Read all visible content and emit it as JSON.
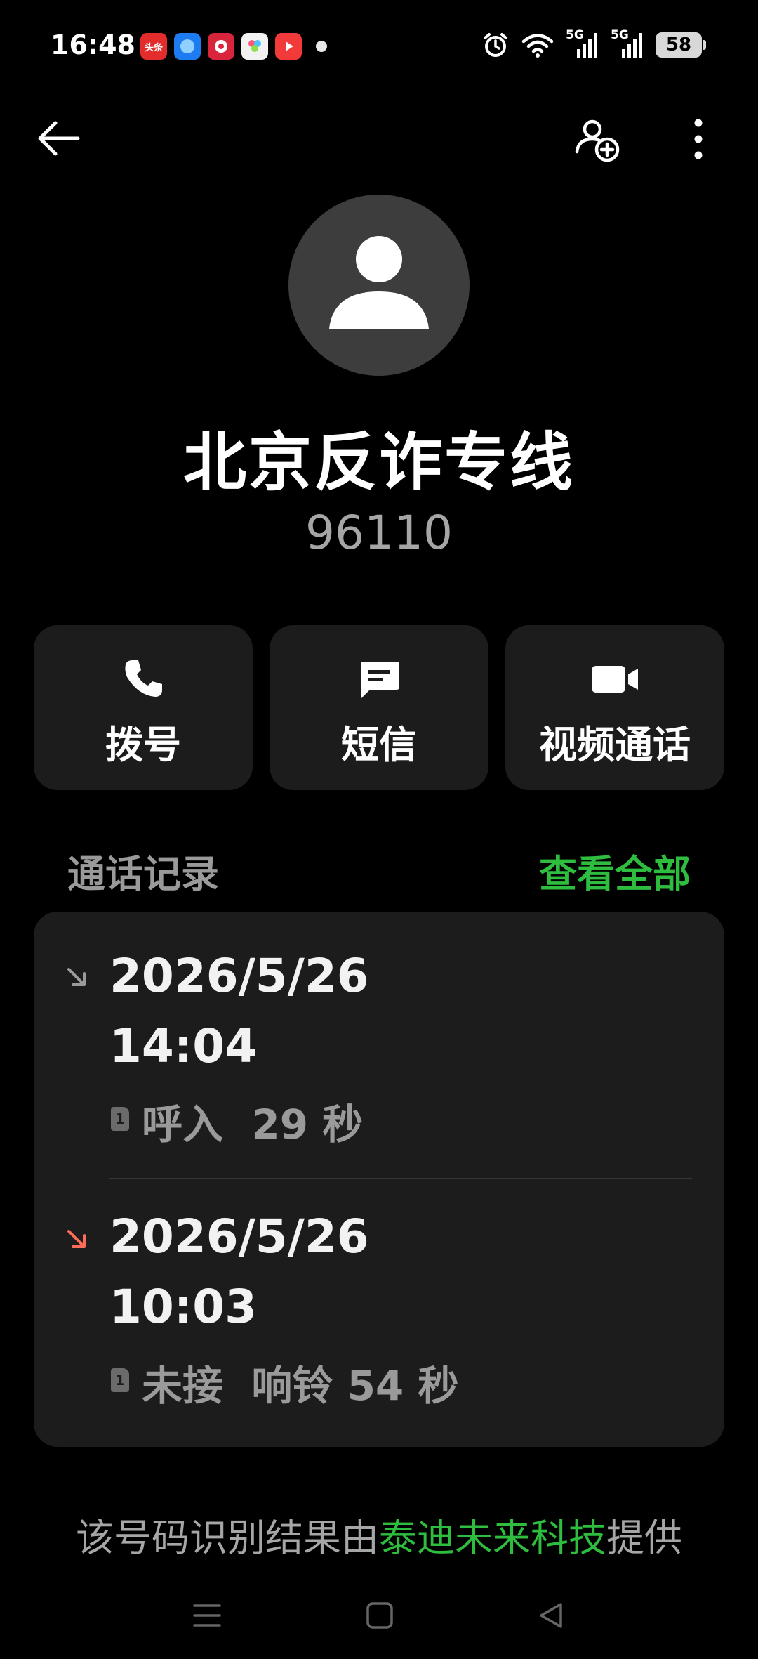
{
  "status_bar": {
    "time": "16:48",
    "app_icons": [
      {
        "name": "toutiao-app-icon",
        "text": "头条",
        "color": "#e32d2d"
      },
      {
        "name": "browser-app-icon",
        "text": "",
        "color": "#1e7cf2"
      },
      {
        "name": "game-app-icon",
        "text": "",
        "color": "#d9253b"
      },
      {
        "name": "gallery-app-icon",
        "text": "",
        "color": "#f2f2f2"
      },
      {
        "name": "video-app-icon",
        "text": "",
        "color": "#f23a3a"
      }
    ],
    "network_1": "5G",
    "network_2": "5G",
    "battery": "58"
  },
  "contact": {
    "name": "北京反诈专线",
    "number": "96110"
  },
  "actions": {
    "call": "拨号",
    "sms": "短信",
    "video_call": "视频通话"
  },
  "call_log": {
    "title": "通话记录",
    "view_all": "查看全部",
    "entries": [
      {
        "date": "2026/5/26",
        "time": "14:04",
        "sim": "1",
        "detail": "呼入  29 秒",
        "type": "incoming",
        "icon_color": "#9a9a9a"
      },
      {
        "date": "2026/5/26",
        "time": "10:03",
        "sim": "1",
        "detail": "未接  响铃 54 秒",
        "type": "missed",
        "icon_color": "#ff6b5a"
      }
    ]
  },
  "footer": {
    "prefix": "该号码识别结果由",
    "provider": "泰迪未来科技",
    "suffix": "提供"
  },
  "colors": {
    "accent_green": "#2ebd3e",
    "card_bg": "#1c1c1c",
    "missed_red": "#ff6b5a"
  }
}
